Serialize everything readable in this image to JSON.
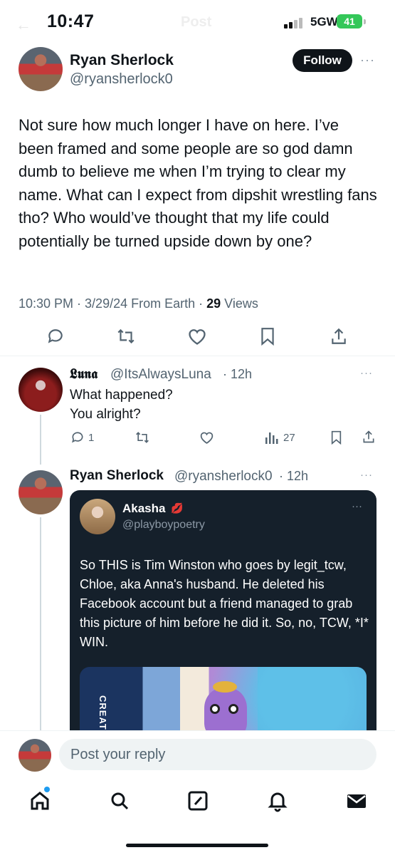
{
  "status_bar": {
    "time": "10:47",
    "network": "5GW",
    "battery": "41",
    "ghost_title": "Post"
  },
  "main_post": {
    "author_name": "Ryan Sherlock",
    "author_handle": "@ryansherlock0",
    "follow_label": "Follow",
    "more_label": "···",
    "text": "Not sure how much longer I have on here. I’ve been framed and some people are so god damn dumb to believe me when I’m trying to clear my name. What can I expect from dipshit wrestling fans tho? Who would’ve thought that my life could potentially be turned upside down by one?",
    "timestamp": "10:30 PM · 3/29/24 From Earth · ",
    "views_count": "29",
    "views_label": " Views",
    "actions": [
      "reply-icon",
      "repost-icon",
      "like-icon",
      "bookmark-icon",
      "share-icon"
    ]
  },
  "reply_luna": {
    "author_name": "𝕷𝖚𝖓𝖆",
    "author_handle": "@ItsAlwaysLuna",
    "time": "· 12h",
    "more_label": "···",
    "line1": "What happened?",
    "line2": "You alright?",
    "reply_count": "1",
    "views_count": "27"
  },
  "reply_ryan": {
    "author_name": "Ryan Sherlock",
    "author_handle": "@ryansherlock0",
    "time": "· 12h",
    "more_label": "···"
  },
  "quoted_post": {
    "author_name": "Akasha",
    "author_handle": "@playboypoetry",
    "more_label": "···",
    "text": "So THIS is Tim Winston who goes by legit_tcw, Chloe, aka Anna's husband. He deleted his Facebook account but a friend managed to grab this picture of him before he did it. So, no, TCW, *I* WIN.",
    "image_text": "CREATE"
  },
  "composer": {
    "placeholder": "Post your reply"
  },
  "tab_bar": {
    "items": [
      "home-icon",
      "search-icon",
      "compose-icon",
      "notifications-icon",
      "messages-icon"
    ]
  },
  "colors": {
    "accent": "#1d9bf0",
    "text": "#0f1419",
    "muted": "#536471",
    "quote_bg": "#15202b",
    "battery": "#34c759"
  }
}
